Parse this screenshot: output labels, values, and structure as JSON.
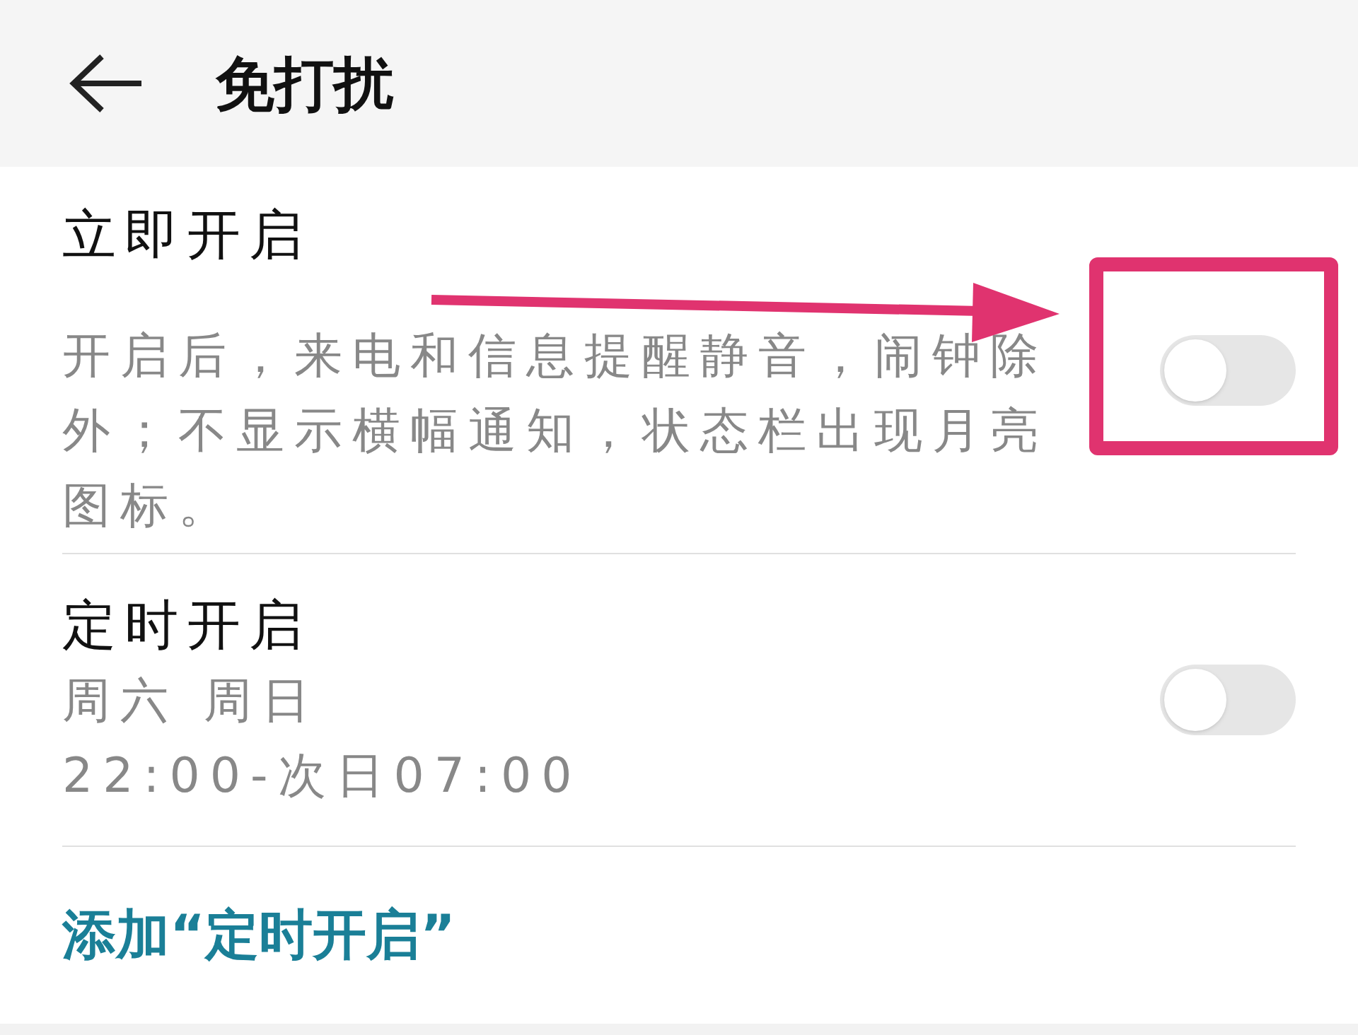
{
  "header": {
    "title": "免打扰"
  },
  "items": [
    {
      "title": "立即开启",
      "lines": [
        "开启后，来电和信息提醒静音，闹钟除外；不显示横幅通知，状态栏出现月亮图标。"
      ],
      "on": false
    },
    {
      "title": "定时开启",
      "lines": [
        "周六 周日",
        "22:00-次日07:00"
      ],
      "on": false
    }
  ],
  "add_link": "添加“定时开启”"
}
